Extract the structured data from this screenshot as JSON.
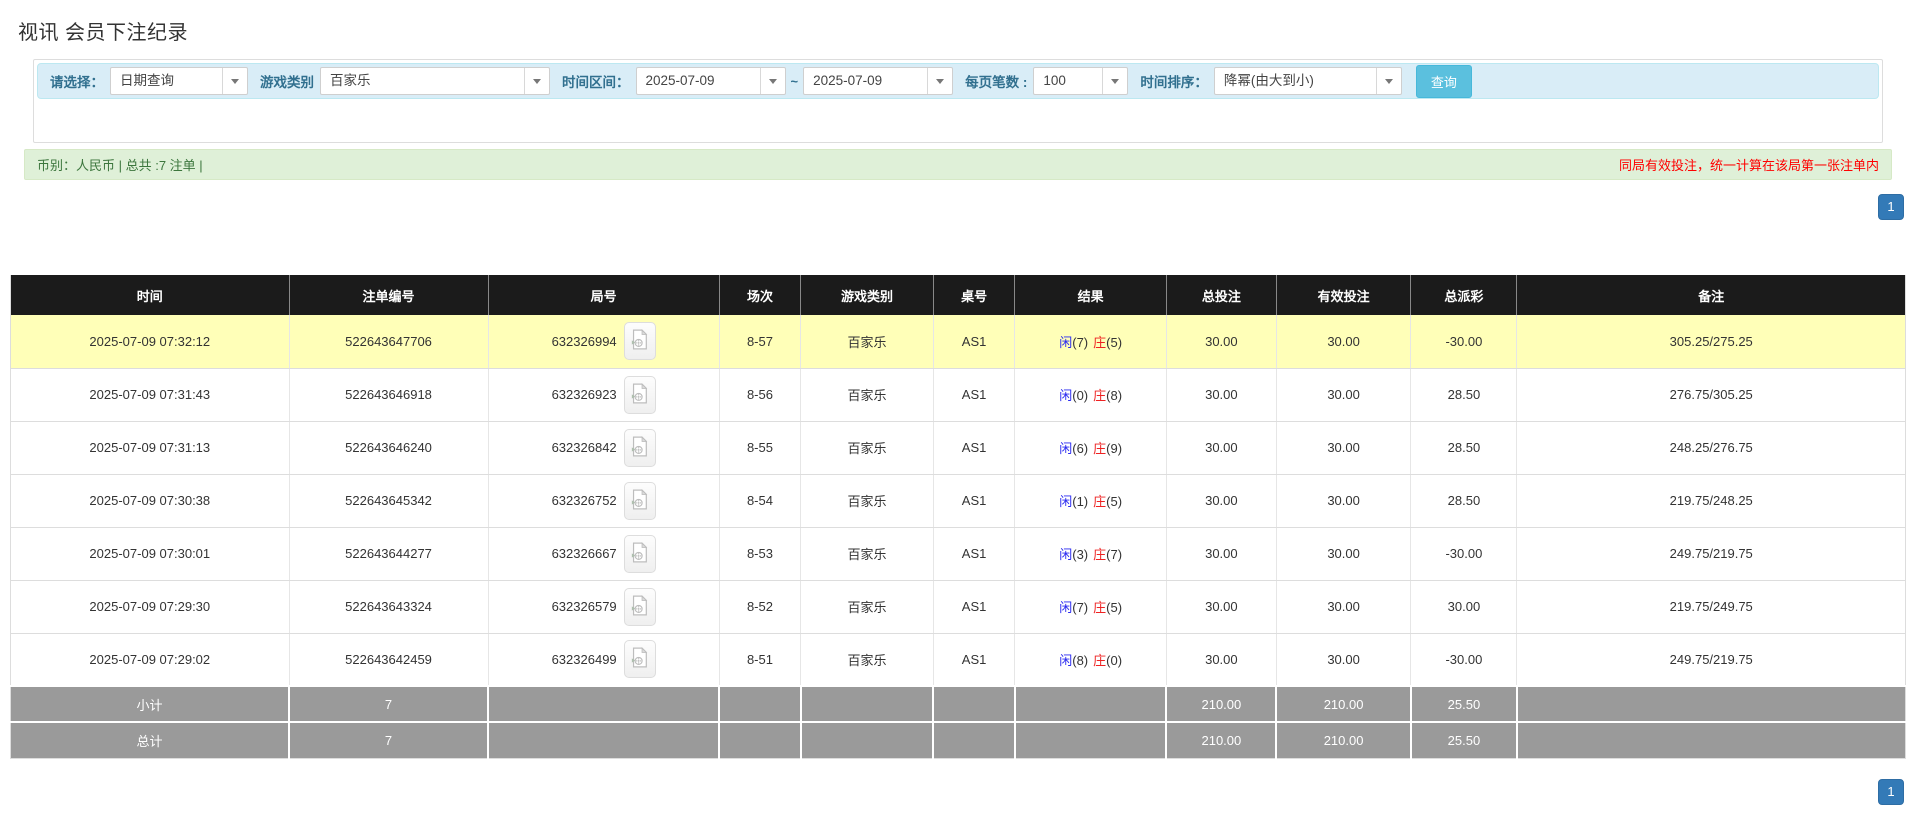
{
  "title": "视讯 会员下注纪录",
  "filters": {
    "query_type": {
      "label": "请选择：",
      "value": "日期查询"
    },
    "game_type": {
      "label": "游戏类别",
      "value": "百家乐"
    },
    "time_range": {
      "label": "时间区间：",
      "from": "2025-07-09",
      "tilde": "~",
      "to": "2025-07-09"
    },
    "page_size": {
      "label": "每页笔数 :",
      "value": "100"
    },
    "time_sort": {
      "label": "时间排序：",
      "value": "降幂(由大到小)"
    },
    "search_label": "查询"
  },
  "summary_bar": {
    "left": "币别：人民币 | 总共 :7 注单 |",
    "right_note": "同局有效投注，统一计算在该局第一张注单内"
  },
  "pagination": {
    "page": "1"
  },
  "icons": {
    "video_icon": "video-replay-icon",
    "caret_icon": "chevron-down-icon"
  },
  "colors": {
    "accent-blue": "#5bc0de",
    "pagination-blue": "#337ab7",
    "header-bg": "#1b1b1b",
    "highlight-yellow": "#ffffb8",
    "summary-gray": "#9a9a9a",
    "filter-bg": "#d9edf7",
    "green-bg": "#dff0d8",
    "green-text": "#3c763d",
    "label-blue": "#31708f",
    "bet-link-blue": "#1766d1",
    "player-blue": "#2a2af0",
    "banker-red": "#ee2222",
    "negative-red": "#ff0000"
  },
  "table": {
    "headers": [
      "时间",
      "注单编号",
      "局号",
      "场次",
      "游戏类别",
      "桌号",
      "结果",
      "总投注",
      "有效投注",
      "总派彩",
      "备注"
    ],
    "rows": [
      {
        "time": "2025-07-09 07:32:12",
        "bet_id": "522643647706",
        "round_id": "632326994",
        "session": "8-57",
        "game": "百家乐",
        "table_no": "AS1",
        "result": {
          "player_label": "闲",
          "player_score": "(7)",
          "banker_label": "庄",
          "banker_score": "(5)"
        },
        "total_bet": "30.00",
        "valid_bet": "30.00",
        "payout": "-30.00",
        "remark": "305.25/275.25",
        "highlight": true
      },
      {
        "time": "2025-07-09 07:31:43",
        "bet_id": "522643646918",
        "round_id": "632326923",
        "session": "8-56",
        "game": "百家乐",
        "table_no": "AS1",
        "result": {
          "player_label": "闲",
          "player_score": "(0)",
          "banker_label": "庄",
          "banker_score": "(8)"
        },
        "total_bet": "30.00",
        "valid_bet": "30.00",
        "payout": "28.50",
        "remark": "276.75/305.25",
        "highlight": false
      },
      {
        "time": "2025-07-09 07:31:13",
        "bet_id": "522643646240",
        "round_id": "632326842",
        "session": "8-55",
        "game": "百家乐",
        "table_no": "AS1",
        "result": {
          "player_label": "闲",
          "player_score": "(6)",
          "banker_label": "庄",
          "banker_score": "(9)"
        },
        "total_bet": "30.00",
        "valid_bet": "30.00",
        "payout": "28.50",
        "remark": "248.25/276.75",
        "highlight": false
      },
      {
        "time": "2025-07-09 07:30:38",
        "bet_id": "522643645342",
        "round_id": "632326752",
        "session": "8-54",
        "game": "百家乐",
        "table_no": "AS1",
        "result": {
          "player_label": "闲",
          "player_score": "(1)",
          "banker_label": "庄",
          "banker_score": "(5)"
        },
        "total_bet": "30.00",
        "valid_bet": "30.00",
        "payout": "28.50",
        "remark": "219.75/248.25",
        "highlight": false
      },
      {
        "time": "2025-07-09 07:30:01",
        "bet_id": "522643644277",
        "round_id": "632326667",
        "session": "8-53",
        "game": "百家乐",
        "table_no": "AS1",
        "result": {
          "player_label": "闲",
          "player_score": "(3)",
          "banker_label": "庄",
          "banker_score": "(7)"
        },
        "total_bet": "30.00",
        "valid_bet": "30.00",
        "payout": "-30.00",
        "remark": "249.75/219.75",
        "highlight": false
      },
      {
        "time": "2025-07-09 07:29:30",
        "bet_id": "522643643324",
        "round_id": "632326579",
        "session": "8-52",
        "game": "百家乐",
        "table_no": "AS1",
        "result": {
          "player_label": "闲",
          "player_score": "(7)",
          "banker_label": "庄",
          "banker_score": "(5)"
        },
        "total_bet": "30.00",
        "valid_bet": "30.00",
        "payout": "30.00",
        "remark": "219.75/249.75",
        "highlight": false
      },
      {
        "time": "2025-07-09 07:29:02",
        "bet_id": "522643642459",
        "round_id": "632326499",
        "session": "8-51",
        "game": "百家乐",
        "table_no": "AS1",
        "result": {
          "player_label": "闲",
          "player_score": "(8)",
          "banker_label": "庄",
          "banker_score": "(0)"
        },
        "total_bet": "30.00",
        "valid_bet": "30.00",
        "payout": "-30.00",
        "remark": "249.75/219.75",
        "highlight": false
      }
    ],
    "subtotal": {
      "label": "小计",
      "count": "7",
      "total_bet": "210.00",
      "valid_bet": "210.00",
      "payout": "25.50"
    },
    "grand_total": {
      "label": "总计",
      "count": "7",
      "total_bet": "210.00",
      "valid_bet": "210.00",
      "payout": "25.50"
    }
  }
}
